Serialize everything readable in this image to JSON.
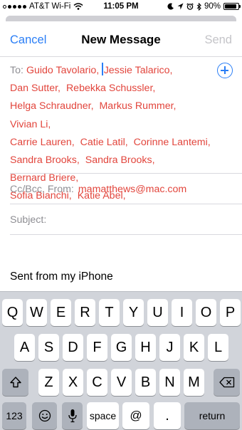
{
  "status_bar": {
    "carrier": "AT&T Wi-Fi",
    "time": "11:05 PM",
    "battery": "90%",
    "battery_level": 0.9
  },
  "nav": {
    "cancel_label": "Cancel",
    "title": "New Message",
    "send_label": "Send"
  },
  "to_field": {
    "label": "To:",
    "recipients": [
      "Guido Tavolario,",
      "Jessie Talarico,",
      "Dan Sutter,",
      "Rebekka Schussler,",
      "Helga Schraudner,",
      "Markus Rummer,",
      "Vivian Li,",
      "Carrie Lauren,",
      "Catie Latil,",
      "Corinne Lantemi,",
      "Sandra Brooks,",
      "Sandra Brooks,",
      "Bernard Briere,",
      "Sofia Bianchi,",
      "Katie Abel,"
    ]
  },
  "cc_bcc": {
    "label": "Cc/Bcc, From:",
    "value": "mamatthews@mac.com"
  },
  "subject": {
    "label": "Subject:"
  },
  "body": {
    "signature": "Sent from my iPhone"
  },
  "keyboard": {
    "row1": [
      "Q",
      "W",
      "E",
      "R",
      "T",
      "Y",
      "U",
      "I",
      "O",
      "P"
    ],
    "row2": [
      "A",
      "S",
      "D",
      "F",
      "G",
      "H",
      "J",
      "K",
      "L"
    ],
    "row3": [
      "Z",
      "X",
      "C",
      "V",
      "B",
      "N",
      "M"
    ],
    "numbers_label": "123",
    "space_label": "space",
    "at_label": "@",
    "period_label": ".",
    "return_label": "return"
  },
  "colors": {
    "accent": "#2a7ef6",
    "recipient": "#e2453c",
    "placeholder": "#8e8e93",
    "keyboard_bg": "#d1d4da"
  },
  "icons": {
    "add_contact": "plus-circle-icon",
    "shift": "shift-arrow-icon",
    "delete": "backspace-icon",
    "emoji": "emoji-face-icon",
    "dictation": "microphone-icon"
  }
}
